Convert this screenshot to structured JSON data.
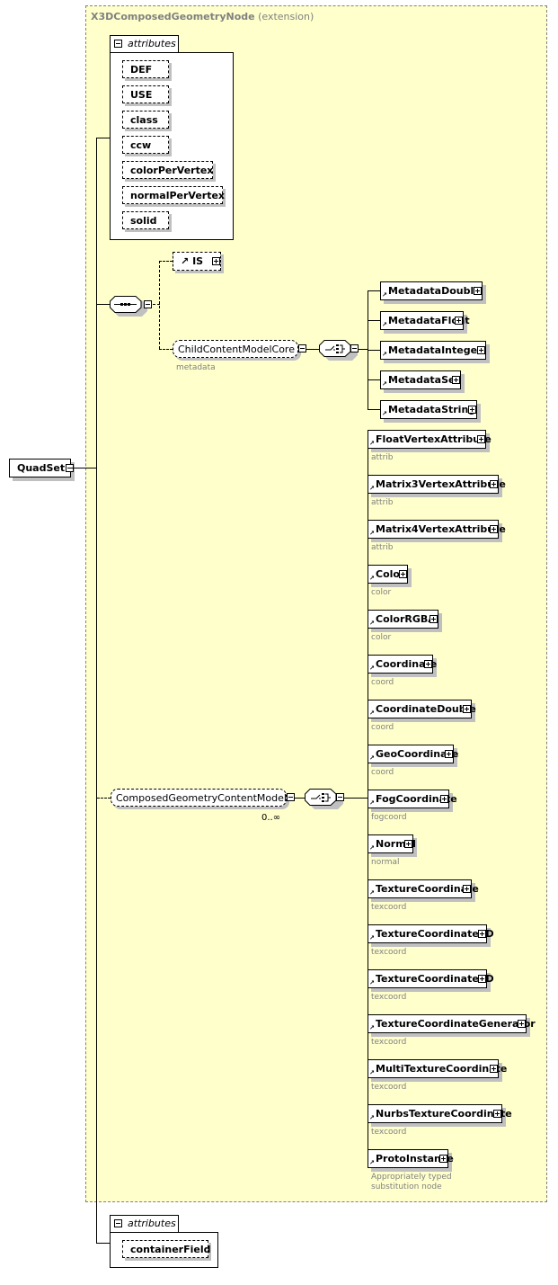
{
  "root": {
    "name": "QuadSet"
  },
  "extension": {
    "type_name": "X3DComposedGeometryNode",
    "suffix": "(extension)"
  },
  "attribute_group_1": {
    "label": "attributes",
    "items": [
      "DEF",
      "USE",
      "class",
      "ccw",
      "colorPerVertex",
      "normalPerVertex",
      "solid"
    ]
  },
  "sequence": {
    "is_element": "IS",
    "core_group": {
      "name": "ChildContentModelCore",
      "sub": "metadata"
    },
    "metadata_choice": [
      "MetadataDouble",
      "MetadataFloat",
      "MetadataInteger",
      "MetadataSet",
      "MetadataString"
    ],
    "geometry_group": {
      "name": "ComposedGeometryContentModel",
      "occurrence": "0..∞"
    },
    "geometry_choice": [
      {
        "name": "FloatVertexAttribute",
        "sub": "attrib"
      },
      {
        "name": "Matrix3VertexAttribute",
        "sub": "attrib"
      },
      {
        "name": "Matrix4VertexAttribute",
        "sub": "attrib"
      },
      {
        "name": "Color",
        "sub": "color"
      },
      {
        "name": "ColorRGBA",
        "sub": "color"
      },
      {
        "name": "Coordinate",
        "sub": "coord"
      },
      {
        "name": "CoordinateDouble",
        "sub": "coord"
      },
      {
        "name": "GeoCoordinate",
        "sub": "coord"
      },
      {
        "name": "FogCoordinate",
        "sub": "fogcoord"
      },
      {
        "name": "Normal",
        "sub": "normal"
      },
      {
        "name": "TextureCoordinate",
        "sub": "texcoord"
      },
      {
        "name": "TextureCoordinate3D",
        "sub": "texcoord"
      },
      {
        "name": "TextureCoordinate4D",
        "sub": "texcoord"
      },
      {
        "name": "TextureCoordinateGenerator",
        "sub": "texcoord"
      },
      {
        "name": "MultiTextureCoordinate",
        "sub": "texcoord"
      },
      {
        "name": "NurbsTextureCoordinate",
        "sub": "texcoord"
      },
      {
        "name": "ProtoInstance",
        "sub_line1": "Appropriately typed",
        "sub_line2": "substitution node"
      }
    ]
  },
  "attribute_group_2": {
    "label": "attributes",
    "items": [
      "containerField"
    ]
  },
  "colors": {
    "extension_bg": "#ffffcc",
    "shadow": "#c0c0c0",
    "annotation": "#808080"
  }
}
